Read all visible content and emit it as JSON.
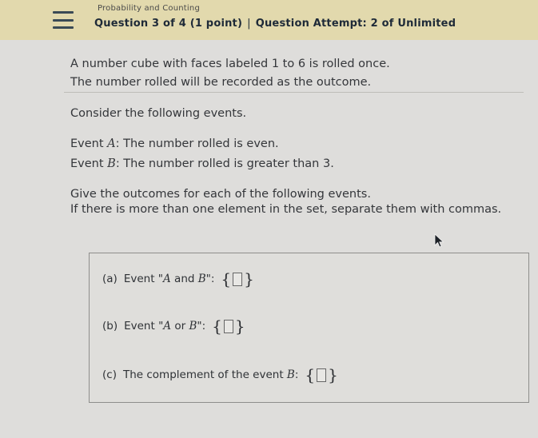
{
  "header": {
    "topic": "Probability and Counting",
    "question_info": "Question 3 of 4 (1 point)",
    "separator": "|",
    "attempt_info": "Question Attempt: 2 of Unlimited"
  },
  "problem": {
    "line1": "A number cube with faces labeled 1 to 6 is rolled once.",
    "line2": "The number rolled will be recorded as the outcome.",
    "consider": "Consider the following events.",
    "eventA_prefix": "Event ",
    "eventA_var": "A",
    "eventA_text": ": The number rolled is even.",
    "eventB_prefix": "Event ",
    "eventB_var": "B",
    "eventB_text": ": The number rolled is greater than 3.",
    "instruction1": "Give the outcomes for each of the following events.",
    "instruction2": "If there is more than one element in the set, separate them with commas."
  },
  "answers": {
    "a_label": "(a)",
    "a_text_pre": "Event \"",
    "a_var1": "A",
    "a_mid": " and ",
    "a_var2": "B",
    "a_text_post": "\":",
    "b_label": "(b)",
    "b_text_pre": "Event \"",
    "b_var1": "A",
    "b_mid": " or ",
    "b_var2": "B",
    "b_text_post": "\":",
    "c_label": "(c)",
    "c_text": "The complement of the event ",
    "c_var": "B",
    "c_colon": ":",
    "brace_open": "{",
    "brace_close": "}"
  },
  "icons": [
    "menu-icon",
    "mouse-cursor-icon"
  ]
}
